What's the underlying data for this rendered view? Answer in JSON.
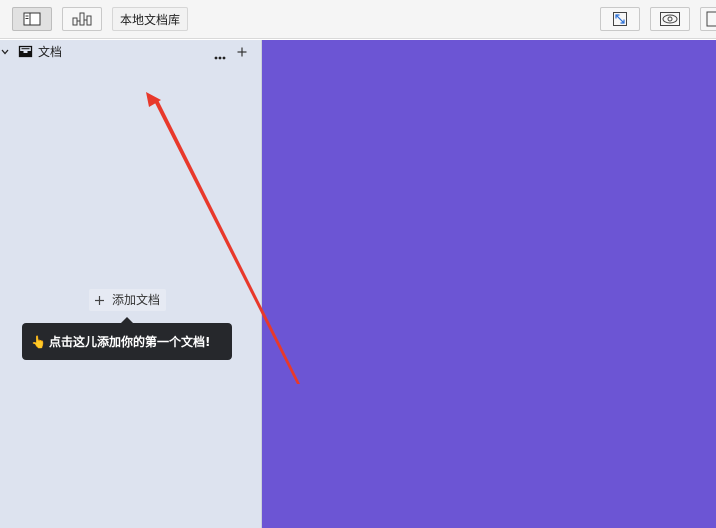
{
  "toolbar": {
    "library_label": "本地文档库"
  },
  "sidebar": {
    "root_label": "文档",
    "add_document_label": "添加文档",
    "tooltip_text": "点击这儿添加你的第一个文档!",
    "tooltip_icon": "👆"
  },
  "icons": {
    "sidebar_toggle": "sidebar-toggle-icon",
    "graph_view": "graph-view-icon",
    "fullscreen": "fullscreen-icon",
    "preview": "eye-icon",
    "root_folder": "inbox-icon",
    "more": "more-icon",
    "add": "plus-icon",
    "expand": "chevron-down-icon"
  },
  "colors": {
    "sidebar_bg": "#dde3ef",
    "canvas_bg": "#6c55d4",
    "tooltip_bg": "#26282c",
    "annotation_arrow": "#e8392b"
  }
}
